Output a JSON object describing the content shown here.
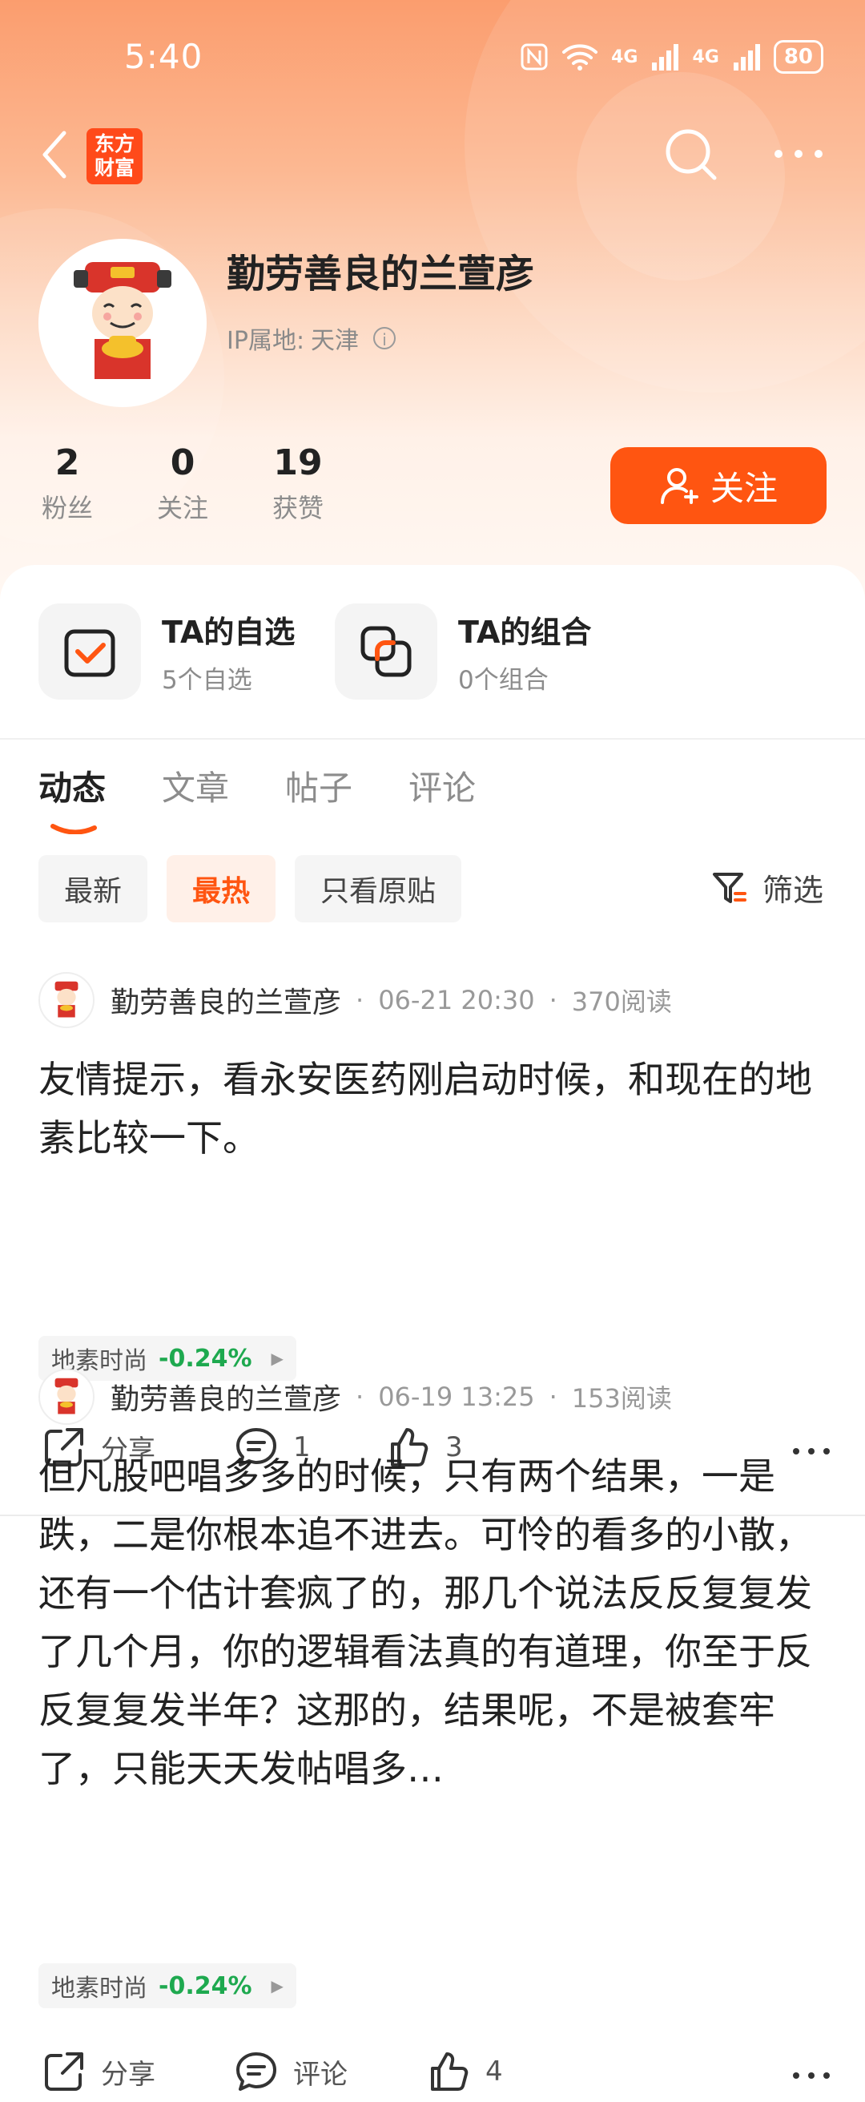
{
  "status_bar": {
    "time": "5:40",
    "net1": "4G",
    "net2": "4G",
    "battery": "80"
  },
  "header": {
    "logo_text": "东方财富"
  },
  "profile": {
    "name": "勤劳善良的兰萱彦",
    "ip_label": "IP属地:",
    "ip_value": "天津",
    "stats": [
      {
        "value": "2",
        "label": "粉丝"
      },
      {
        "value": "0",
        "label": "关注"
      },
      {
        "value": "19",
        "label": "获赞"
      }
    ],
    "follow_label": "关注"
  },
  "entries": [
    {
      "title": "TA的自选",
      "sub": "5个自选",
      "icon": "checkbox-icon"
    },
    {
      "title": "TA的组合",
      "sub": "0个组合",
      "icon": "portfolio-icon"
    }
  ],
  "tabs": [
    "动态",
    "文章",
    "帖子",
    "评论"
  ],
  "active_tab": "动态",
  "filters": [
    "最新",
    "最热",
    "只看原贴"
  ],
  "active_filter": "最热",
  "filter_button": "筛选",
  "posts": [
    {
      "author": "勤劳善良的兰萱彦",
      "date": "06-21 20:30",
      "reads": "370阅读",
      "body": "友情提示，看永安医药刚启动时候，和现在的地素比较一下。",
      "stock_name": "地素时尚",
      "stock_change": "-0.24%",
      "share_label": "分享",
      "comment_label": "1",
      "like_label": "3"
    },
    {
      "author": "勤劳善良的兰萱彦",
      "date": "06-19 13:25",
      "reads": "153阅读",
      "body": "但凡股吧唱多多的时候，只有两个结果，一是跌，二是你根本追不进去。可怜的看多的小散，还有一个估计套疯了的，那几个说法反反复复发了几个月，你的逻辑看法真的有道理，你至于反反复复发半年？这那的，结果呢，不是被套牢了，只能天天发帖唱多…",
      "stock_name": "地素时尚",
      "stock_change": "-0.24%",
      "share_label": "分享",
      "comment_label": "评论",
      "like_label": "4"
    }
  ],
  "colors": {
    "accent": "#ff5511",
    "positive_green": "#1ea94f",
    "hero_top": "#fb9d6e"
  }
}
